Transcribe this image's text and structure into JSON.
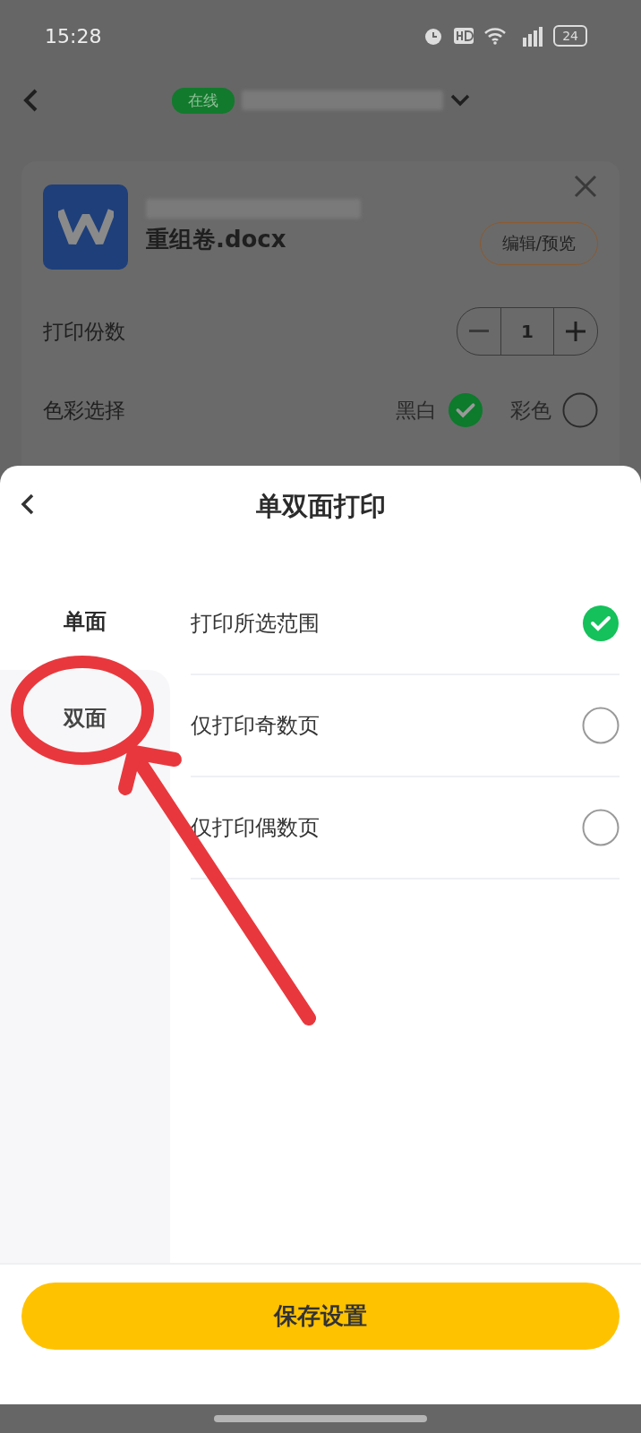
{
  "status_bar": {
    "time": "15:28",
    "battery": "24"
  },
  "header": {
    "status_badge": "在线"
  },
  "file": {
    "name": "重组卷.docx",
    "edit_button": "编辑/预览"
  },
  "copies": {
    "label": "打印份数",
    "value": "1"
  },
  "color_mode": {
    "label": "色彩选择",
    "options": [
      {
        "label": "黑白",
        "selected": true
      },
      {
        "label": "彩色",
        "selected": false
      }
    ]
  },
  "sheet": {
    "title": "单双面打印",
    "tabs": [
      {
        "label": "单面",
        "selected": true
      },
      {
        "label": "双面",
        "selected": false
      }
    ],
    "options": [
      {
        "label": "打印所选范围",
        "selected": true
      },
      {
        "label": "仅打印奇数页",
        "selected": false
      },
      {
        "label": "仅打印偶数页",
        "selected": false
      }
    ],
    "save_button": "保存设置"
  }
}
